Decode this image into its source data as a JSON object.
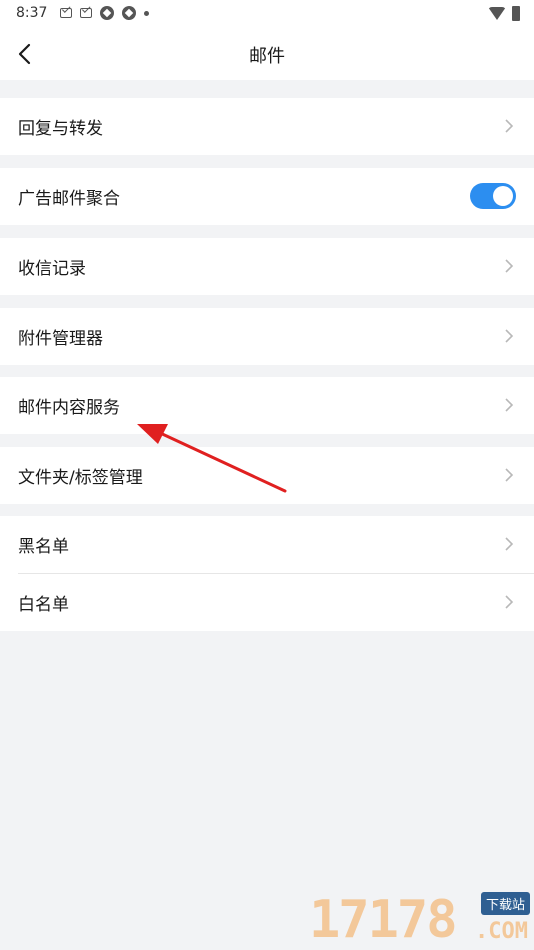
{
  "status_bar": {
    "time": "8:37"
  },
  "nav": {
    "title": "邮件"
  },
  "groups": [
    {
      "items": [
        {
          "label": "回复与转发",
          "type": "link"
        }
      ]
    },
    {
      "items": [
        {
          "label": "广告邮件聚合",
          "type": "toggle",
          "on": true
        }
      ]
    },
    {
      "items": [
        {
          "label": "收信记录",
          "type": "link"
        }
      ]
    },
    {
      "items": [
        {
          "label": "附件管理器",
          "type": "link"
        }
      ]
    },
    {
      "items": [
        {
          "label": "邮件内容服务",
          "type": "link"
        }
      ]
    },
    {
      "items": [
        {
          "label": "文件夹/标签管理",
          "type": "link"
        }
      ]
    },
    {
      "items": [
        {
          "label": "黑名单",
          "type": "link"
        },
        {
          "label": "白名单",
          "type": "link"
        }
      ]
    }
  ],
  "colors": {
    "accent": "#2c8ef0",
    "background": "#f2f3f5",
    "annotation_arrow": "#e02020"
  },
  "watermark": {
    "number": "17178",
    "tag": "下载站",
    "suffix": ".COM"
  }
}
